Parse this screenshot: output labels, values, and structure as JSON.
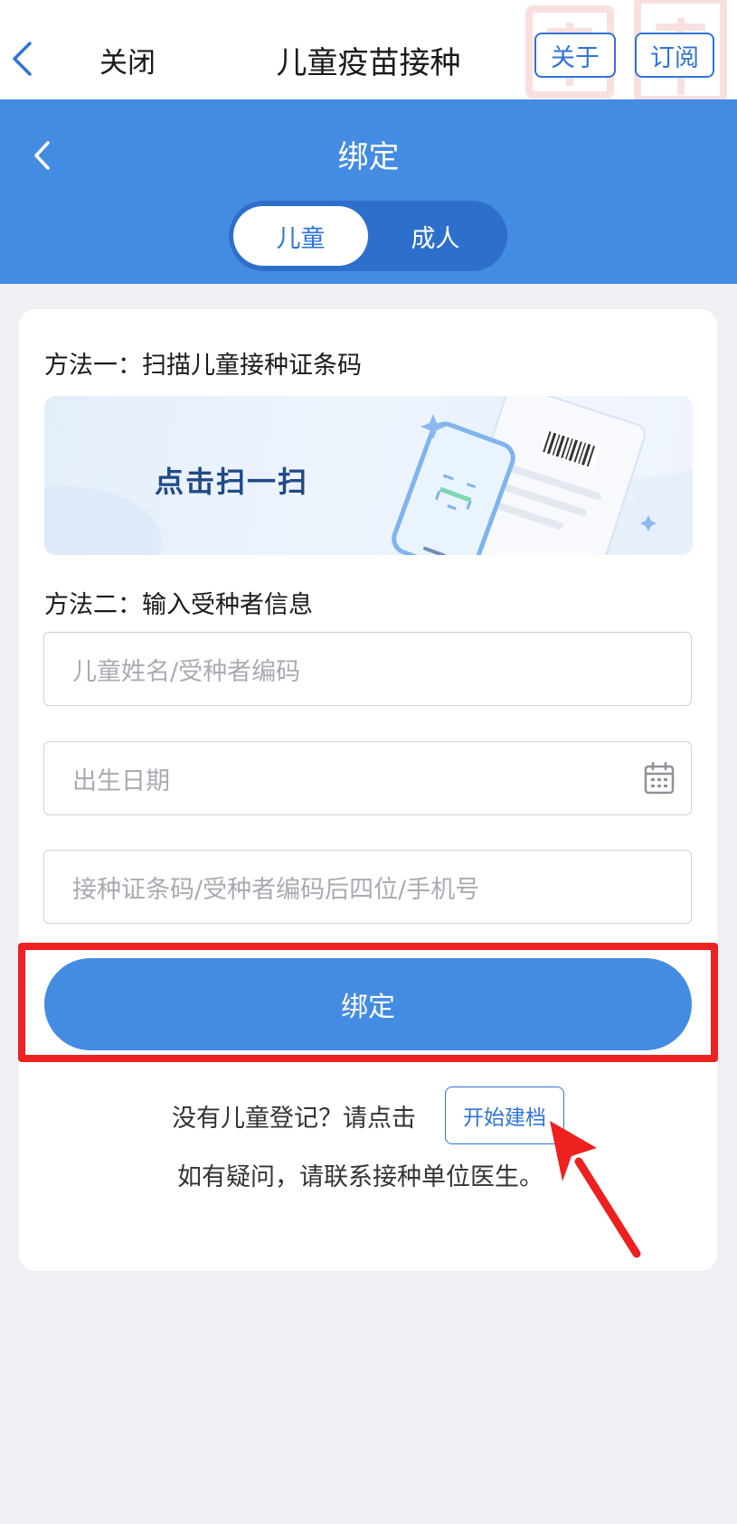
{
  "topbar": {
    "close_label": "关闭",
    "title": "儿童疫苗接种",
    "about_label": "关于",
    "subscribe_label": "订阅",
    "back_icon": "chevron-left-icon"
  },
  "header": {
    "title": "绑定",
    "back_icon": "chevron-left-icon",
    "tabs": [
      {
        "label": "儿童",
        "active": true
      },
      {
        "label": "成人",
        "active": false
      }
    ]
  },
  "method1": {
    "label": "方法一：扫描儿童接种证条码",
    "scan_text": "点击扫一扫"
  },
  "method2": {
    "label": "方法二：输入受种者信息",
    "name_placeholder": "儿童姓名/受种者编码",
    "birth_placeholder": "出生日期",
    "code_placeholder": "接种证条码/受种者编码后四位/手机号"
  },
  "bind_button": "绑定",
  "footer": {
    "no_record_text": "没有儿童登记？请点击",
    "start_button": "开始建档",
    "contact_text": "如有疑问，请联系接种单位医生。"
  },
  "colors": {
    "primary": "#448be2",
    "link": "#2f73d6",
    "highlight": "#ee2020",
    "background": "#efeff4"
  }
}
